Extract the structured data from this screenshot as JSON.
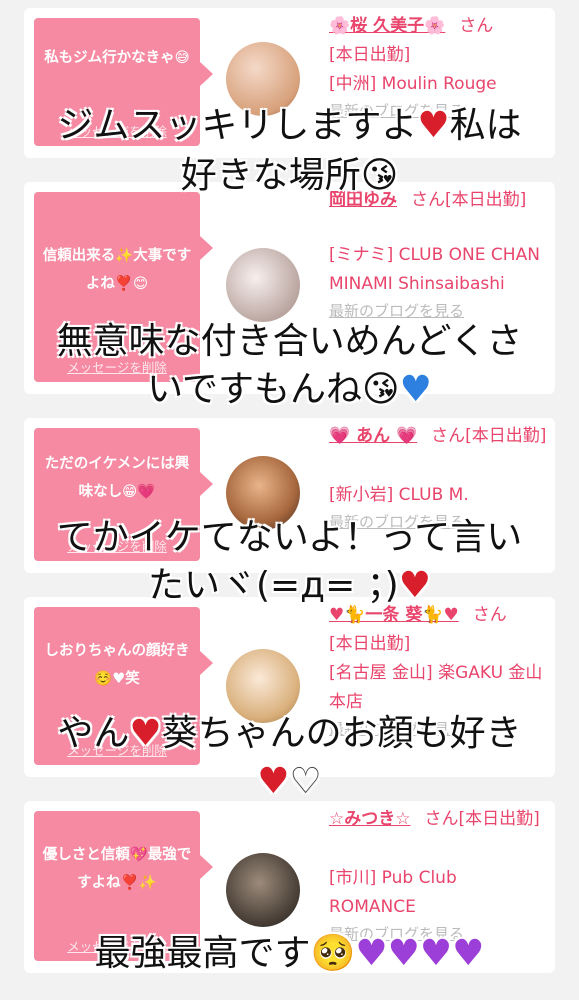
{
  "delete_label": "メッセージを削除",
  "blog_label": "最新のブログを見る",
  "san_label": "さん",
  "cards": [
    {
      "message": "私もジム行かなきゃ😅",
      "name": "🌸桜 久美子🌸",
      "lines": [
        "[本日出勤]",
        "[中洲] Moulin Rouge"
      ],
      "avatar_colors": [
        "#f4d9c8",
        "#d7a07a"
      ]
    },
    {
      "message": "信頼出来る✨大事ですよね❣️😊",
      "name": "岡田ゆみ",
      "name_suffix": "さん[本日出勤]",
      "lines": [
        "[ミナミ] CLUB ONE CHAN MINAMI Shinsaibashi"
      ],
      "avatar_colors": [
        "#efe6e6",
        "#b7a29c"
      ]
    },
    {
      "message": "ただのイケメンには興味なし😁💗",
      "name": "💗 あん 💗",
      "name_suffix": "さん[本日出勤]",
      "lines": [
        "[新小岩] CLUB M."
      ],
      "avatar_colors": [
        "#5a3a2e",
        "#c8936a"
      ]
    },
    {
      "message": "しおりちゃんの顔好き☺️♥笑",
      "name": "♥🐈一条 葵🐈♥",
      "lines": [
        "[本日出勤]",
        "[名古屋 金山] 楽GAKU 金山本店"
      ],
      "avatar_colors": [
        "#f6e2cf",
        "#d9b07c"
      ]
    },
    {
      "message": "優しさと信頼💖最強ですよね❣️✨",
      "name": "☆みつき☆",
      "name_suffix": "さん[本日出勤]",
      "lines": [
        "[市川] Pub Club ROMANCE"
      ],
      "avatar_colors": [
        "#3b3b3b",
        "#8b7a6a"
      ]
    }
  ],
  "overlays": [
    {
      "text": "ジムスッキリしますよ",
      "heart": "♥",
      "rest": "私は"
    },
    {
      "text": "好きな場所😘"
    },
    {
      "text": "無意味な付き合いめんどくさ"
    },
    {
      "text": "いですもんね😘",
      "heart_blue": "♥"
    },
    {
      "text": "てかイケてないよ！って言い"
    },
    {
      "text": "たいヾ(=д= ；)",
      "heart": "♥"
    },
    {
      "text": "やん",
      "heart": "♥",
      "rest": "葵ちゃんのお顔も好き"
    },
    {
      "heart": "♥",
      "heart_white": "♡"
    },
    {
      "text": "最強最高です🥺",
      "hearts_purple": "♥♥♥♥"
    }
  ]
}
